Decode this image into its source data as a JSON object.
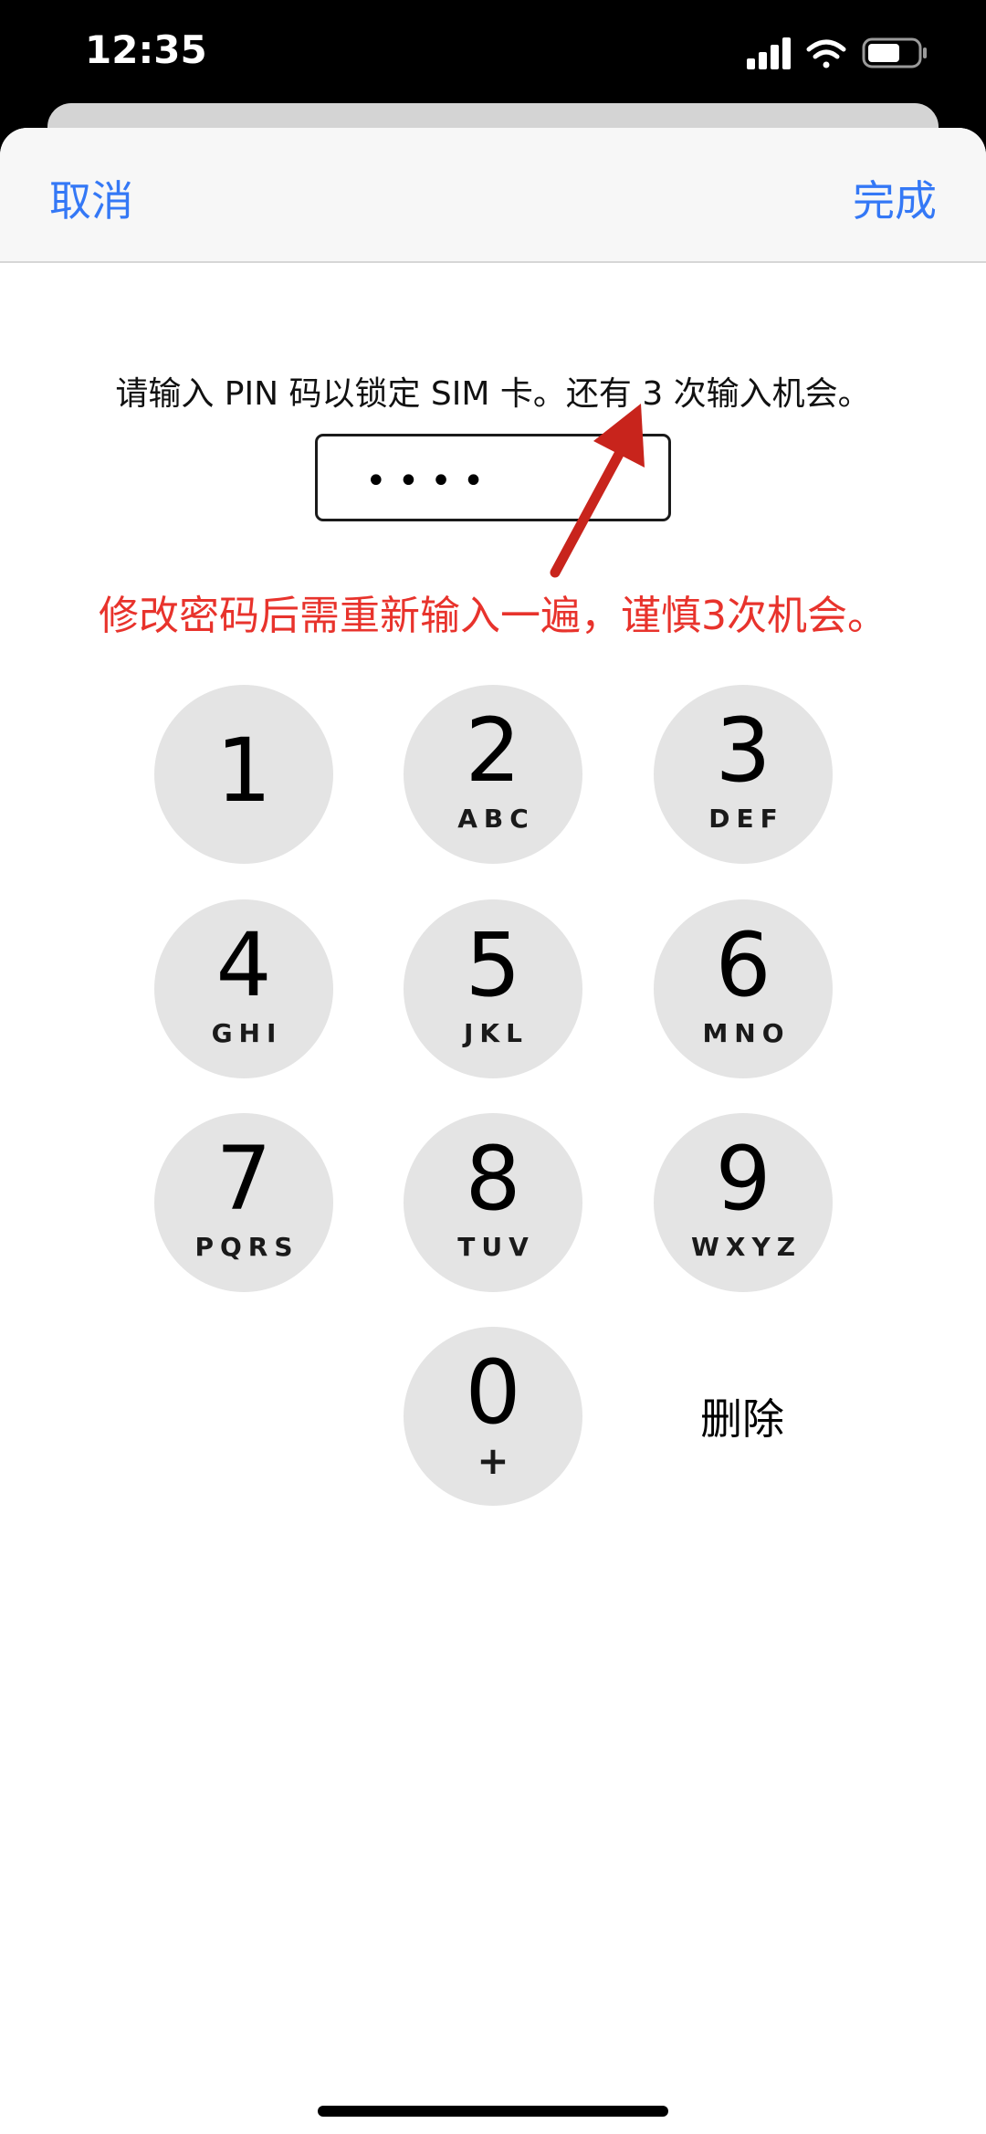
{
  "status_bar": {
    "time": "12:35"
  },
  "nav": {
    "cancel_label": "取消",
    "done_label": "完成"
  },
  "prompt": "请输入 PIN 码以锁定 SIM 卡。还有 3 次输入机会。",
  "pin_field": {
    "value": "••••"
  },
  "annotation": "修改密码后需重新输入一遍，谨慎3次机会。",
  "keypad": {
    "keys": [
      {
        "digit": "1",
        "letters": ""
      },
      {
        "digit": "2",
        "letters": "ABC"
      },
      {
        "digit": "3",
        "letters": "DEF"
      },
      {
        "digit": "4",
        "letters": "GHI"
      },
      {
        "digit": "5",
        "letters": "JKL"
      },
      {
        "digit": "6",
        "letters": "MNO"
      },
      {
        "digit": "7",
        "letters": "PQRS"
      },
      {
        "digit": "8",
        "letters": "TUV"
      },
      {
        "digit": "9",
        "letters": "WXYZ"
      }
    ],
    "zero": {
      "digit": "0",
      "sub": "+"
    },
    "delete_label": "删除"
  },
  "colors": {
    "accent": "#3478f6",
    "annotation": "#e8332c",
    "key_bg": "#e4e4e4"
  }
}
